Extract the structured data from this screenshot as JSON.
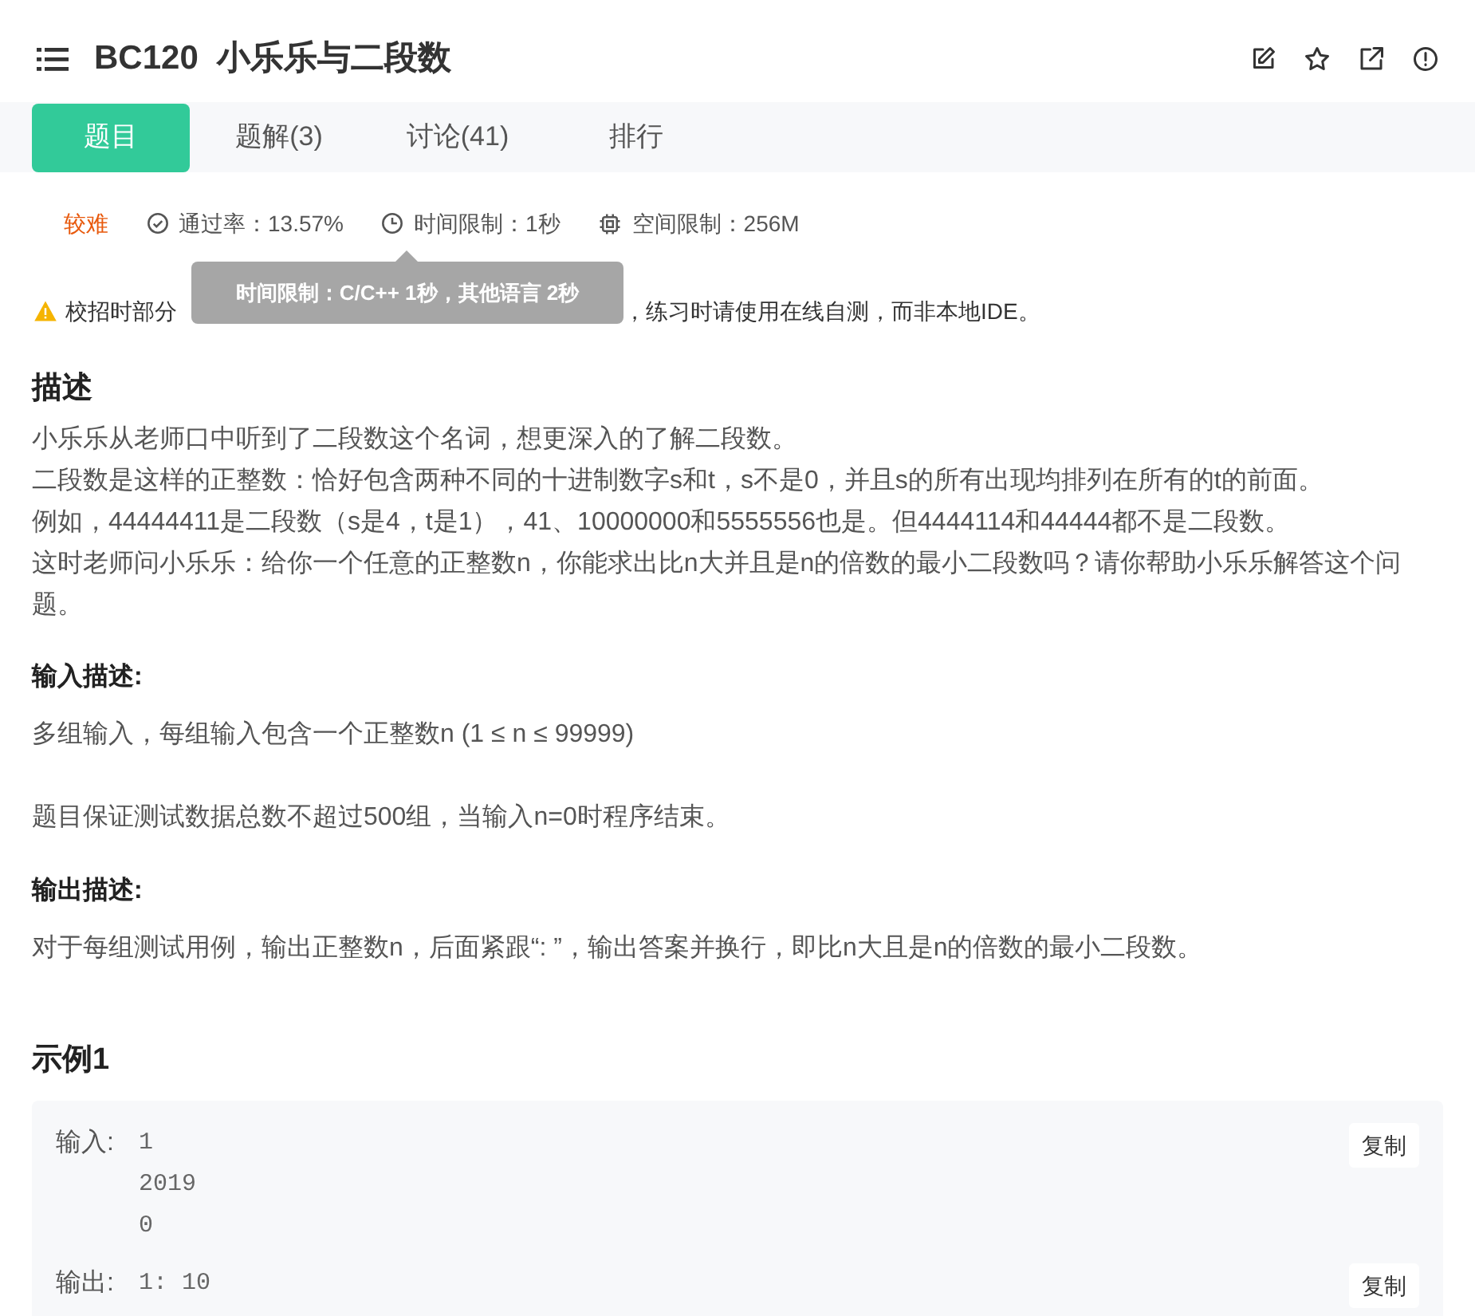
{
  "header": {
    "title": "BC120  小乐乐与二段数"
  },
  "tabs": [
    {
      "label": "题目",
      "selected": true
    },
    {
      "label": "题解(3)",
      "selected": false
    },
    {
      "label": "讨论(41)",
      "selected": false
    },
    {
      "label": "排行",
      "selected": false
    }
  ],
  "meta": {
    "difficulty": "较难",
    "pass_rate": "通过率：13.57%",
    "time_limit": "时间限制：1秒",
    "memory_limit": "空间限制：256M"
  },
  "tooltip": "时间限制：C/C++ 1秒，其他语言 2秒",
  "notice": {
    "before_tooltip": "校招时部分",
    "after_tooltip": "，练习时请使用在线自测，而非本地IDE。"
  },
  "description": {
    "heading": "描述",
    "lines": [
      "小乐乐从老师口中听到了二段数这个名词，想更深入的了解二段数。",
      "二段数是这样的正整数：恰好包含两种不同的十进制数字s和t，s不是0，并且s的所有出现均排列在所有的t的前面。",
      "例如，44444411是二段数（s是4，t是1），41、10000000和5555556也是。但4444114和44444都不是二段数。",
      "这时老师问小乐乐：给你一个任意的正整数n，你能求出比n大并且是n的倍数的最小二段数吗？请你帮助小乐乐解答这个问题。"
    ]
  },
  "input_desc": {
    "heading": "输入描述:",
    "paragraphs": [
      "多组输入，每组输入包含一个正整数n (1 ≤ n ≤ 99999)",
      "题目保证测试数据总数不超过500组，当输入n=0时程序结束。"
    ]
  },
  "output_desc": {
    "heading": "输出描述:",
    "paragraphs": [
      "对于每组测试用例，输出正整数n，后面紧跟“: ”，输出答案并换行，即比n大且是n的倍数的最小二段数。"
    ]
  },
  "example": {
    "heading": "示例1",
    "blocks": [
      {
        "label": "输入:",
        "lines": [
          "1",
          "2019",
          "0"
        ],
        "copy": "复制"
      },
      {
        "label": "输出:",
        "lines": [
          "1: 10"
        ],
        "copy": "复制"
      }
    ]
  }
}
